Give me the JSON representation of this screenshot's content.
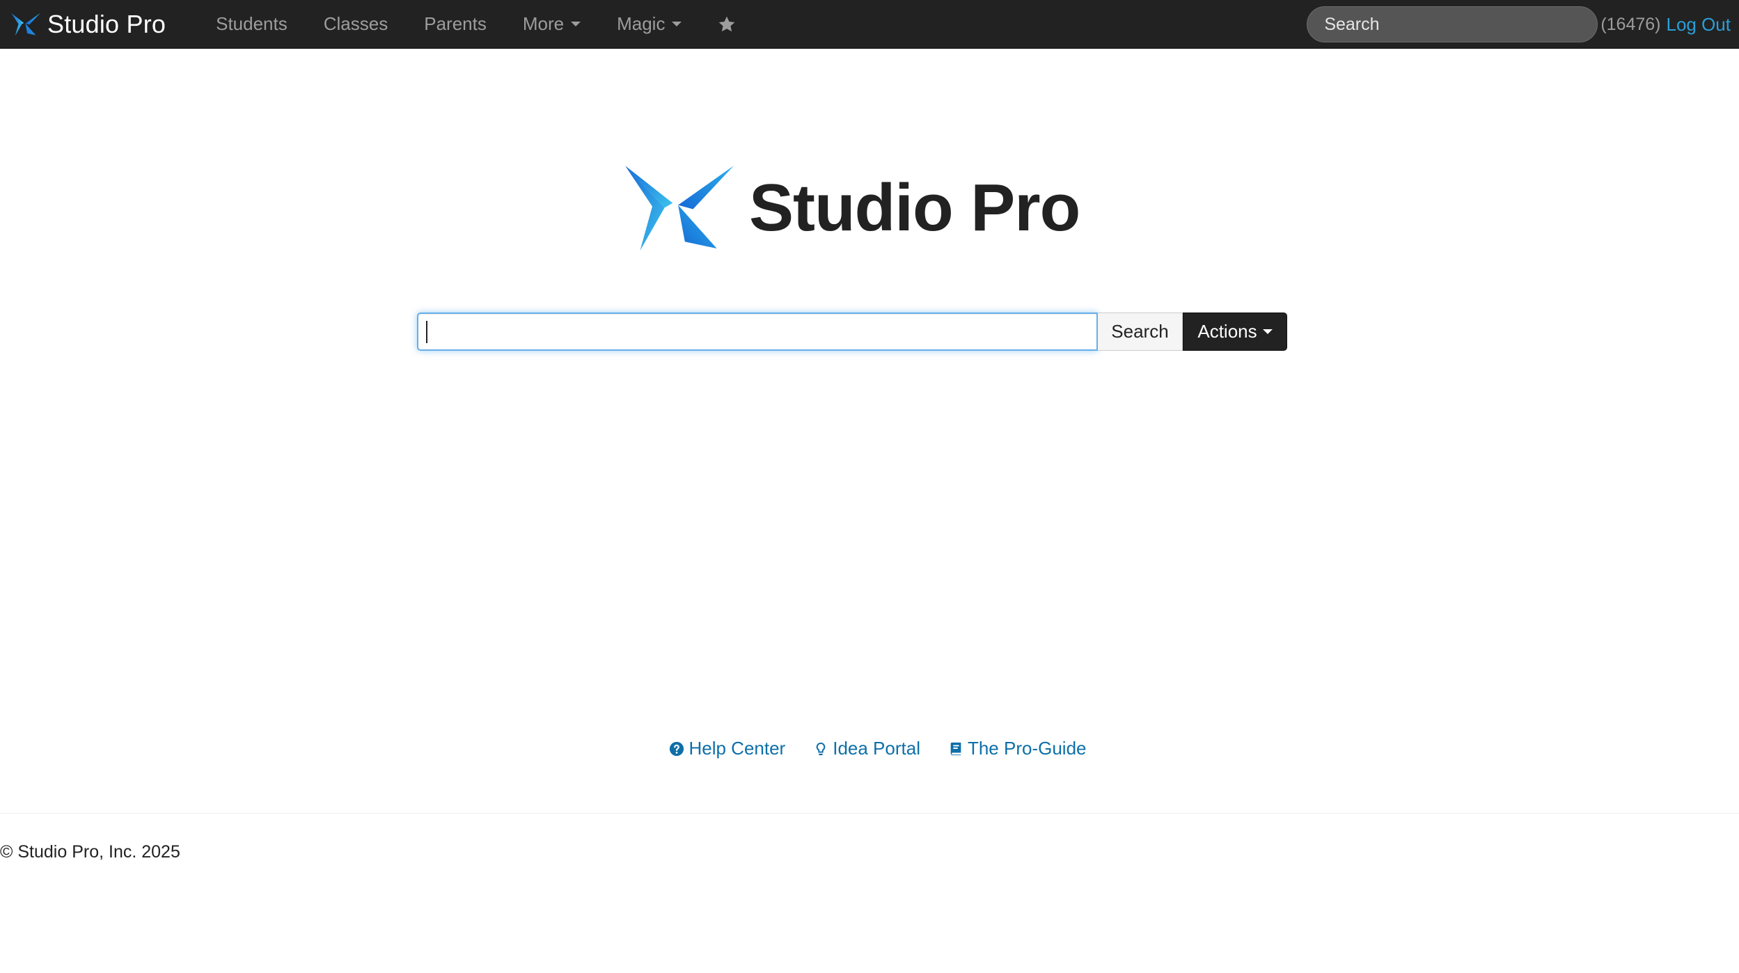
{
  "navbar": {
    "brand": "Studio Pro",
    "items": [
      {
        "label": "Students"
      },
      {
        "label": "Classes"
      },
      {
        "label": "Parents"
      },
      {
        "label": "More"
      },
      {
        "label": "Magic"
      }
    ],
    "search_placeholder": "Search",
    "user_id": "(16476)",
    "logout_label": "Log Out"
  },
  "hero": {
    "title": "Studio Pro",
    "search_value": "",
    "search_button": "Search",
    "actions_button": "Actions"
  },
  "footer": {
    "links": [
      {
        "label": "Help Center",
        "icon": "question-circle-icon"
      },
      {
        "label": "Idea Portal",
        "icon": "lightbulb-icon"
      },
      {
        "label": "The Pro-Guide",
        "icon": "book-icon"
      }
    ],
    "copyright": "© Studio Pro, Inc. 2025"
  },
  "colors": {
    "navbar_bg": "#222222",
    "link": "#0d6fa8",
    "logout": "#2a9fd6",
    "logo_light": "#3fc3ee",
    "logo_dark": "#1569d6"
  }
}
